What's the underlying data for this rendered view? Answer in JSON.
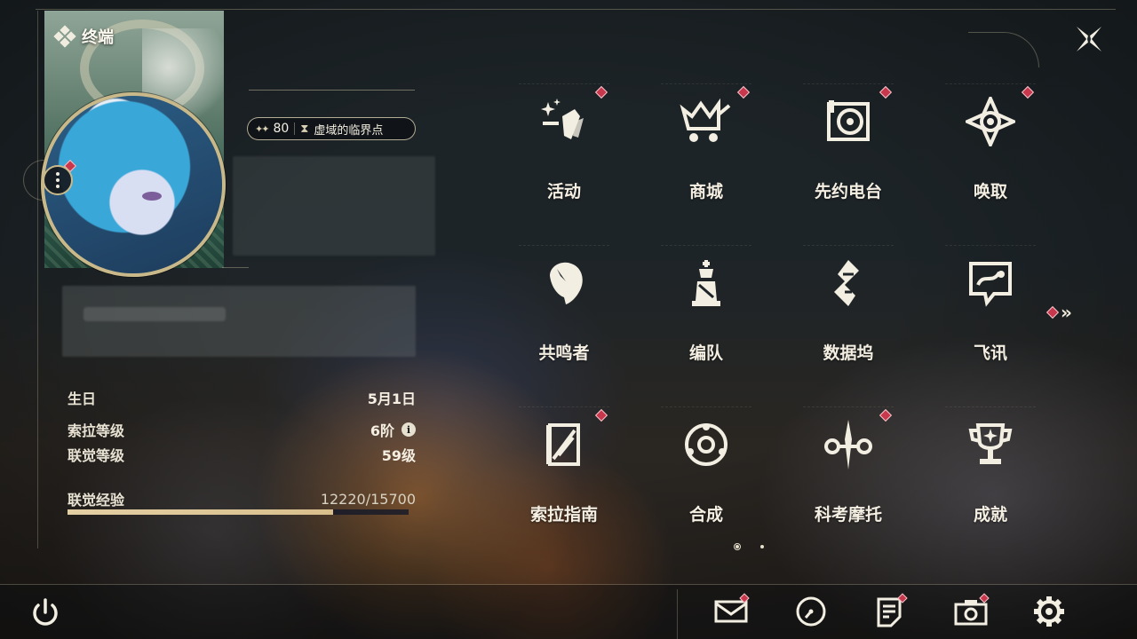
{
  "header": {
    "title": "终端"
  },
  "profile": {
    "level_badge": {
      "level": "80",
      "region": "虚域的临界点"
    }
  },
  "stats": [
    {
      "label": "生日",
      "value": "5月1日"
    },
    {
      "label": "索拉等级",
      "value": "6阶",
      "info_icon": "info-icon"
    },
    {
      "label": "联觉等级",
      "value": "59级"
    },
    {
      "label": "联觉经验",
      "value": "12220/15700"
    }
  ],
  "exp": {
    "current": 12220,
    "max": 15700
  },
  "menu": [
    {
      "label": "活动",
      "icon": "events-icon",
      "notify": true
    },
    {
      "label": "商城",
      "icon": "shop-crown-cart-icon",
      "notify": true
    },
    {
      "label": "先约电台",
      "icon": "radio-vinyl-icon",
      "notify": true
    },
    {
      "label": "唤取",
      "icon": "convene-star-icon",
      "notify": true
    },
    {
      "label": "共鸣者",
      "icon": "resonator-head-icon",
      "notify": false
    },
    {
      "label": "编队",
      "icon": "chess-team-icon",
      "notify": false
    },
    {
      "label": "数据坞",
      "icon": "data-dock-icon",
      "notify": false
    },
    {
      "label": "飞讯",
      "icon": "chat-bubble-icon",
      "notify": false
    },
    {
      "label": "索拉指南",
      "icon": "guide-book-icon",
      "notify": true
    },
    {
      "label": "合成",
      "icon": "synthesis-ring-icon",
      "notify": false
    },
    {
      "label": "科考摩托",
      "icon": "motorcycle-icon",
      "notify": true
    },
    {
      "label": "成就",
      "icon": "trophy-icon",
      "notify": false
    }
  ],
  "pagination": {
    "pages": 2,
    "current": 1
  },
  "bottom_bar": [
    {
      "icon": "mail-icon",
      "notify": true
    },
    {
      "icon": "clock-icon",
      "notify": false
    },
    {
      "icon": "notes-icon",
      "notify": true
    },
    {
      "icon": "camera-icon",
      "notify": true
    },
    {
      "icon": "settings-gear-icon",
      "notify": false
    }
  ],
  "colors": {
    "accent": "#c9b98a",
    "notify": "#c8374c",
    "text": "#f4efe2",
    "exp_fill": "#e3cfa4"
  }
}
